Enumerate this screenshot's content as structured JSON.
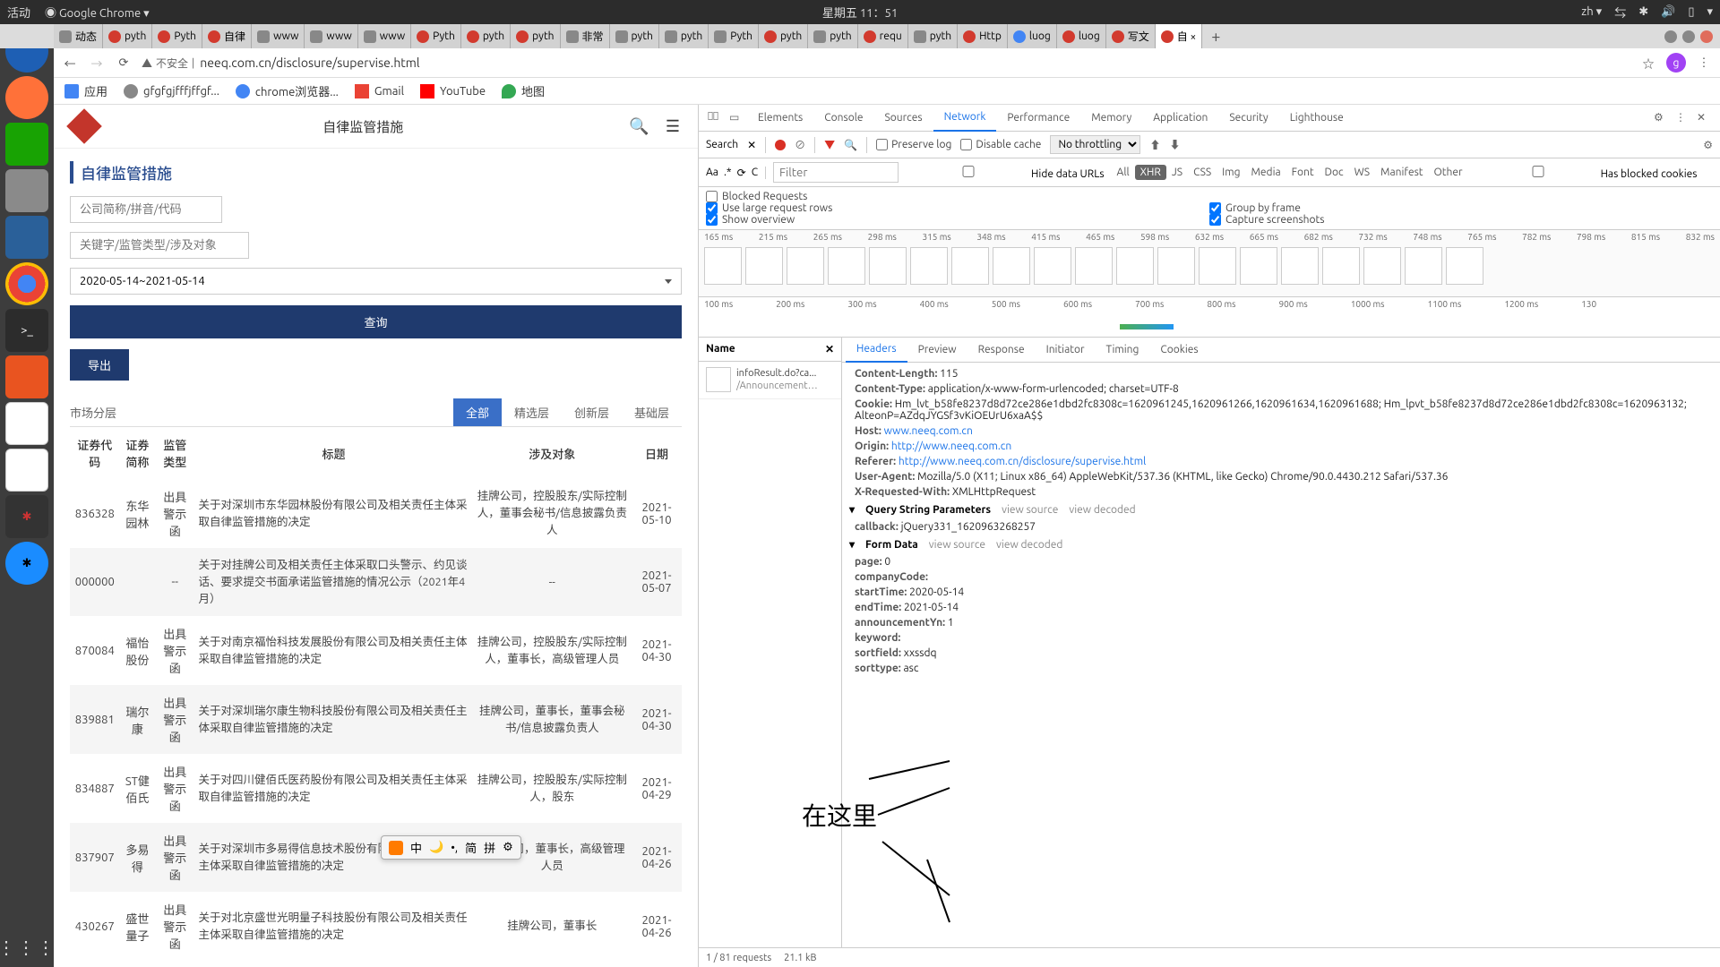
{
  "os": {
    "activity": "活动",
    "app": "Google Chrome",
    "clock": "星期五 11：51",
    "lang": "zh"
  },
  "tabs": {
    "items": [
      {
        "label": "动态",
        "fav": "grey"
      },
      {
        "label": "pyth",
        "fav": "red"
      },
      {
        "label": "Pyth",
        "fav": "red"
      },
      {
        "label": "自律",
        "fav": "red"
      },
      {
        "label": "www",
        "fav": "grey"
      },
      {
        "label": "www",
        "fav": "grey"
      },
      {
        "label": "www",
        "fav": "grey"
      },
      {
        "label": "Pyth",
        "fav": "red"
      },
      {
        "label": "pyth",
        "fav": "red"
      },
      {
        "label": "pyth",
        "fav": "red"
      },
      {
        "label": "非常",
        "fav": "grey"
      },
      {
        "label": "pyth",
        "fav": "grey"
      },
      {
        "label": "pyth",
        "fav": "grey"
      },
      {
        "label": "Pyth",
        "fav": "grey"
      },
      {
        "label": "pyth",
        "fav": "red"
      },
      {
        "label": "pyth",
        "fav": "grey"
      },
      {
        "label": "requ",
        "fav": "red"
      },
      {
        "label": "pyth",
        "fav": "grey"
      },
      {
        "label": "Http",
        "fav": "red"
      },
      {
        "label": "luog",
        "fav": "blue"
      },
      {
        "label": "luog",
        "fav": "red"
      },
      {
        "label": "写文",
        "fav": "red"
      },
      {
        "label": "自 ×",
        "fav": "red"
      }
    ]
  },
  "url": {
    "insecure": "不安全",
    "address": "neeq.com.cn/disclosure/supervise.html"
  },
  "bookmarks": {
    "apps": "应用",
    "items": [
      "gfgfgjfffjffgf...",
      "chrome浏览器...",
      "Gmail",
      "YouTube",
      "地图"
    ]
  },
  "page": {
    "header_title": "自律监管措施",
    "section_title": "自律监管措施",
    "input1_ph": "公司简称/拼音/代码",
    "input2_ph": "关键字/监管类型/涉及对象",
    "daterange": "2020-05-14~2021-05-14",
    "query": "查询",
    "export": "导出",
    "tier_label": "市场分层",
    "tiers": [
      "全部",
      "精选层",
      "创新层",
      "基础层"
    ],
    "cols": [
      "证券代码",
      "证券简称",
      "监管类型",
      "标题",
      "涉及对象",
      "日期"
    ],
    "rows": [
      {
        "code": "836328",
        "name": "东华园林",
        "type": "出具警示函",
        "title": "关于对深圳市东华园林股份有限公司及相关责任主体采取自律监管措施的决定",
        "subject": "挂牌公司，控股股东/实际控制人，董事会秘书/信息披露负责人",
        "date": "2021-05-10"
      },
      {
        "code": "000000",
        "name": "",
        "type": "--",
        "title": "关于对挂牌公司及相关责任主体采取口头警示、约见谈话、要求提交书面承诺监管措施的情况公示（2021年4月）",
        "subject": "--",
        "date": "2021-05-07"
      },
      {
        "code": "870084",
        "name": "福怡股份",
        "type": "出具警示函",
        "title": "关于对南京福怡科技发展股份有限公司及相关责任主体采取自律监管措施的决定",
        "subject": "挂牌公司，控股股东/实际控制人，董事长，高级管理人员",
        "date": "2021-04-30"
      },
      {
        "code": "839881",
        "name": "瑞尔康",
        "type": "出具警示函",
        "title": "关于对深圳瑞尔康生物科技股份有限公司及相关责任主体采取自律监管措施的决定",
        "subject": "挂牌公司，董事长，董事会秘书/信息披露负责人",
        "date": "2021-04-30"
      },
      {
        "code": "834887",
        "name": "ST健佰氏",
        "type": "出具警示函",
        "title": "关于对四川健佰氏医药股份有限公司及相关责任主体采取自律监管措施的决定",
        "subject": "挂牌公司，控股股东/实际控制人，股东",
        "date": "2021-04-29"
      },
      {
        "code": "837907",
        "name": "多易得",
        "type": "出具警示函",
        "title": "关于对深圳市多易得信息技术股份有限公司及相关责任主体采取自律监管措施的决定",
        "subject": "挂牌公司，董事长，高级管理人员",
        "date": "2021-04-26"
      },
      {
        "code": "430267",
        "name": "盛世量子",
        "type": "出具警示函",
        "title": "关于对北京盛世光明量子科技股份有限公司及相关责任主体采取自律监管措施的决定",
        "subject": "挂牌公司，董事长",
        "date": "2021-04-26"
      }
    ]
  },
  "devtools": {
    "tabs": [
      "Elements",
      "Console",
      "Sources",
      "Network",
      "Performance",
      "Memory",
      "Application",
      "Security",
      "Lighthouse"
    ],
    "search": "Search",
    "toolbar": {
      "preserve": "Preserve log",
      "disable": "Disable cache",
      "throttle": "No throttling"
    },
    "filter_ph": "Filter",
    "hide_urls": "Hide data URLs",
    "types": [
      "All",
      "XHR",
      "JS",
      "CSS",
      "Img",
      "Media",
      "Font",
      "Doc",
      "WS",
      "Manifest",
      "Other"
    ],
    "blocked_cookies": "Has blocked cookies",
    "blocked_req": "Blocked Requests",
    "large_rows": "Use large request rows",
    "group_frame": "Group by frame",
    "show_overview": "Show overview",
    "capture": "Capture screenshots",
    "timeline1": [
      "165 ms",
      "215 ms",
      "265 ms",
      "298 ms",
      "315 ms",
      "348 ms",
      "415 ms",
      "465 ms",
      "598 ms",
      "632 ms",
      "665 ms",
      "682 ms",
      "732 ms",
      "748 ms",
      "765 ms",
      "782 ms",
      "798 ms",
      "815 ms",
      "832 ms"
    ],
    "timeline2": [
      "100 ms",
      "200 ms",
      "300 ms",
      "400 ms",
      "500 ms",
      "600 ms",
      "700 ms",
      "800 ms",
      "900 ms",
      "1000 ms",
      "1100 ms",
      "1200 ms",
      "130"
    ],
    "name_col": "Name",
    "request_name1": "infoResult.do?ca...",
    "request_name2": "/Announcement…",
    "detail_tabs": [
      "Headers",
      "Preview",
      "Response",
      "Initiator",
      "Timing",
      "Cookies"
    ],
    "headers": [
      {
        "k": "Content-Length:",
        "v": "115"
      },
      {
        "k": "Content-Type:",
        "v": "application/x-www-form-urlencoded; charset=UTF-8"
      },
      {
        "k": "Cookie:",
        "v": "Hm_lvt_b58fe8237d8d72ce286e1dbd2fc8308c=1620961245,1620961266,1620961634,1620961688; Hm_lpvt_b58fe8237d8d72ce286e1dbd2fc8308c=1620963132; AlteonP=AZdqJYGSf3vKiOEUrU6xaA$$"
      },
      {
        "k": "Host:",
        "v": "www.neeq.com.cn",
        "link": true
      },
      {
        "k": "Origin:",
        "v": "http://www.neeq.com.cn",
        "link": true
      },
      {
        "k": "Referer:",
        "v": "http://www.neeq.com.cn/disclosure/supervise.html",
        "link": true
      },
      {
        "k": "User-Agent:",
        "v": "Mozilla/5.0 (X11; Linux x86_64) AppleWebKit/537.36 (KHTML, like Gecko) Chrome/90.0.4430.212 Safari/537.36"
      },
      {
        "k": "X-Requested-With:",
        "v": "XMLHttpRequest"
      }
    ],
    "qsp_header": "Query String Parameters",
    "view_source": "view source",
    "view_decoded": "view decoded",
    "qsp": [
      {
        "k": "callback:",
        "v": "jQuery331_1620963268257"
      }
    ],
    "formdata_header": "Form Data",
    "formdata": [
      {
        "k": "page:",
        "v": "0"
      },
      {
        "k": "companyCode:",
        "v": ""
      },
      {
        "k": "startTime:",
        "v": "2020-05-14"
      },
      {
        "k": "endTime:",
        "v": "2021-05-14"
      },
      {
        "k": "announcementYn:",
        "v": "1"
      },
      {
        "k": "keyword:",
        "v": ""
      },
      {
        "k": "sortfield:",
        "v": "xxssdq"
      },
      {
        "k": "sorttype:",
        "v": "asc"
      }
    ],
    "status": {
      "requests": "1 / 81 requests",
      "size": "21.1 kB"
    }
  },
  "ime": {
    "items": [
      "中",
      "🌙",
      "•,",
      "简",
      "拼",
      "⚙"
    ]
  },
  "annotation": "在这里"
}
